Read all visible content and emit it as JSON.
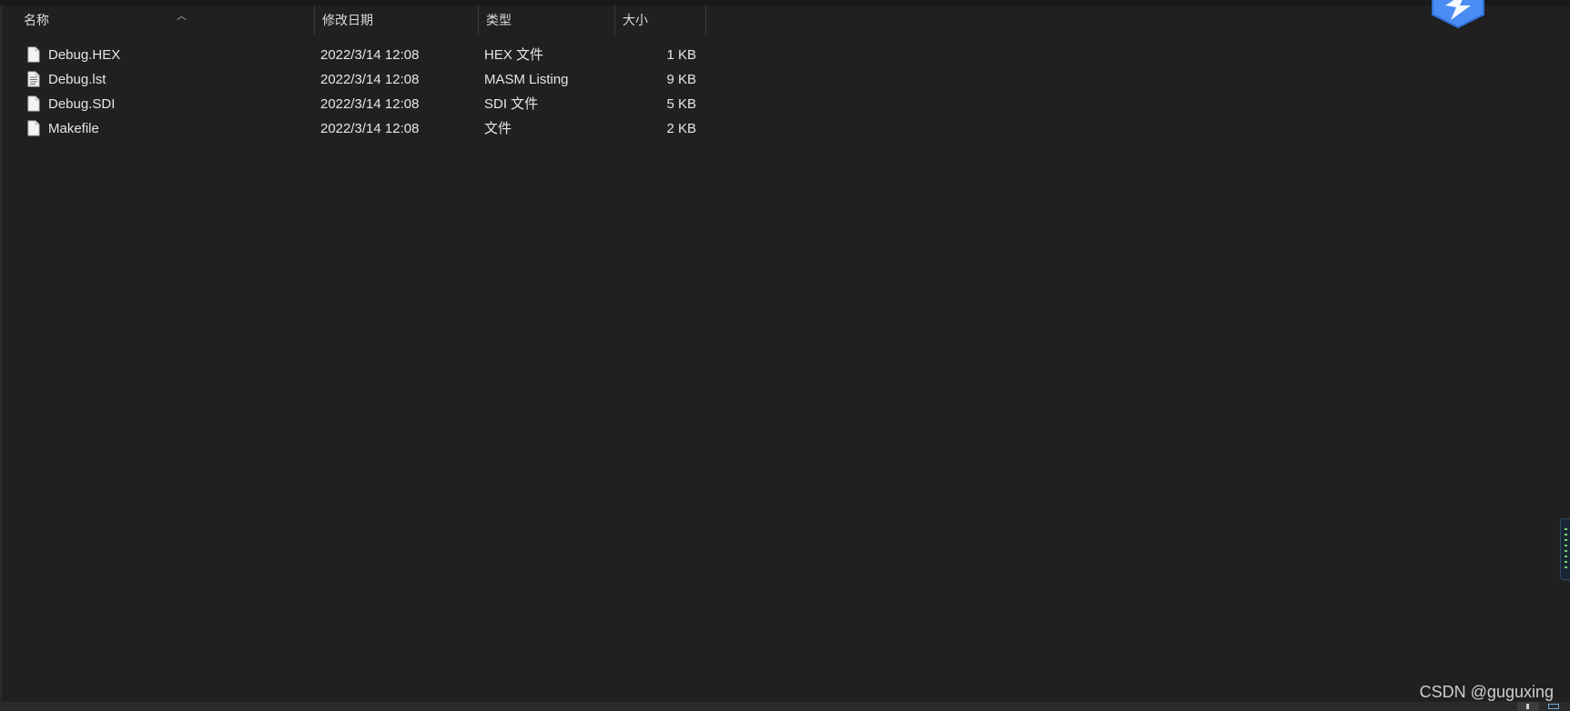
{
  "columns": {
    "name": "名称",
    "date": "修改日期",
    "type": "类型",
    "size": "大小"
  },
  "files": [
    {
      "name": "Debug.HEX",
      "date": "2022/3/14 12:08",
      "type": "HEX 文件",
      "size": "1 KB",
      "icon": "file-icon"
    },
    {
      "name": "Debug.lst",
      "date": "2022/3/14 12:08",
      "type": "MASM Listing",
      "size": "9 KB",
      "icon": "text-file-icon"
    },
    {
      "name": "Debug.SDI",
      "date": "2022/3/14 12:08",
      "type": "SDI 文件",
      "size": "5 KB",
      "icon": "file-icon"
    },
    {
      "name": "Makefile",
      "date": "2022/3/14 12:08",
      "type": "文件",
      "size": "2 KB",
      "icon": "file-icon"
    }
  ],
  "watermark": "CSDN @guguxing",
  "colors": {
    "background": "#202020",
    "text": "#e6e6e6",
    "badge": "#4a8cf2"
  }
}
